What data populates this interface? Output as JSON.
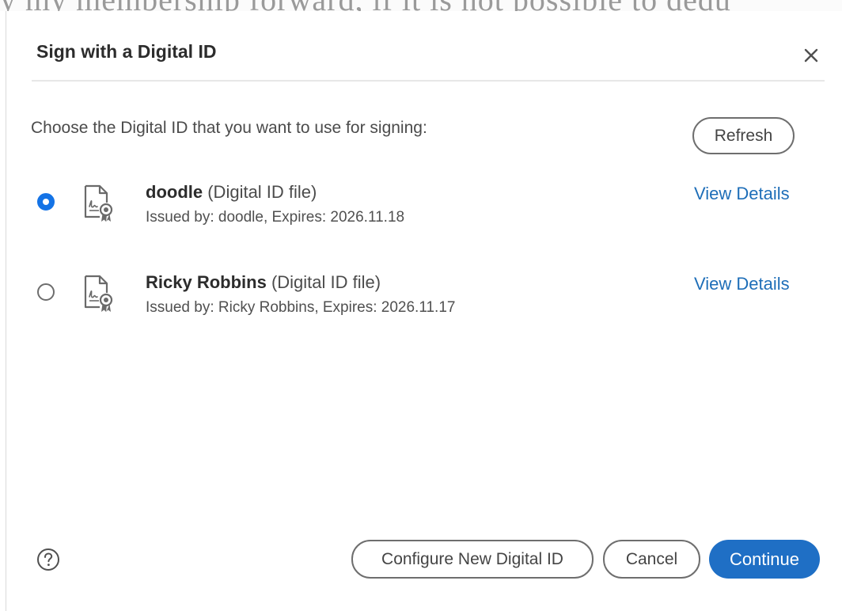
{
  "background_document": {
    "text_fragment": "y my membership forward, if it is not possible to dedu"
  },
  "dialog": {
    "title": "Sign with a Digital ID",
    "close_icon": "close-icon",
    "prompt": "Choose the Digital ID that you want to use for signing:",
    "refresh_label": "Refresh",
    "digital_ids": [
      {
        "name": "doodle",
        "type": "(Digital ID file)",
        "issued": "Issued by: doodle, Expires: 2026.11.18",
        "selected": true,
        "view_details": "View Details",
        "icon": "certificate-file-icon"
      },
      {
        "name": "Ricky Robbins",
        "type": "(Digital ID file)",
        "issued": "Issued by: Ricky Robbins, Expires: 2026.11.17",
        "selected": false,
        "view_details": "View Details",
        "icon": "certificate-file-icon"
      }
    ],
    "footer": {
      "help_icon": "help-icon",
      "configure_label": "Configure New Digital ID",
      "cancel_label": "Cancel",
      "continue_label": "Continue"
    }
  },
  "colors": {
    "accent": "#1473e6",
    "primary_button": "#1f6fc5",
    "link": "#1e6eb8",
    "title_text": "#2c2c2c",
    "body_text": "#4b4b4b"
  }
}
